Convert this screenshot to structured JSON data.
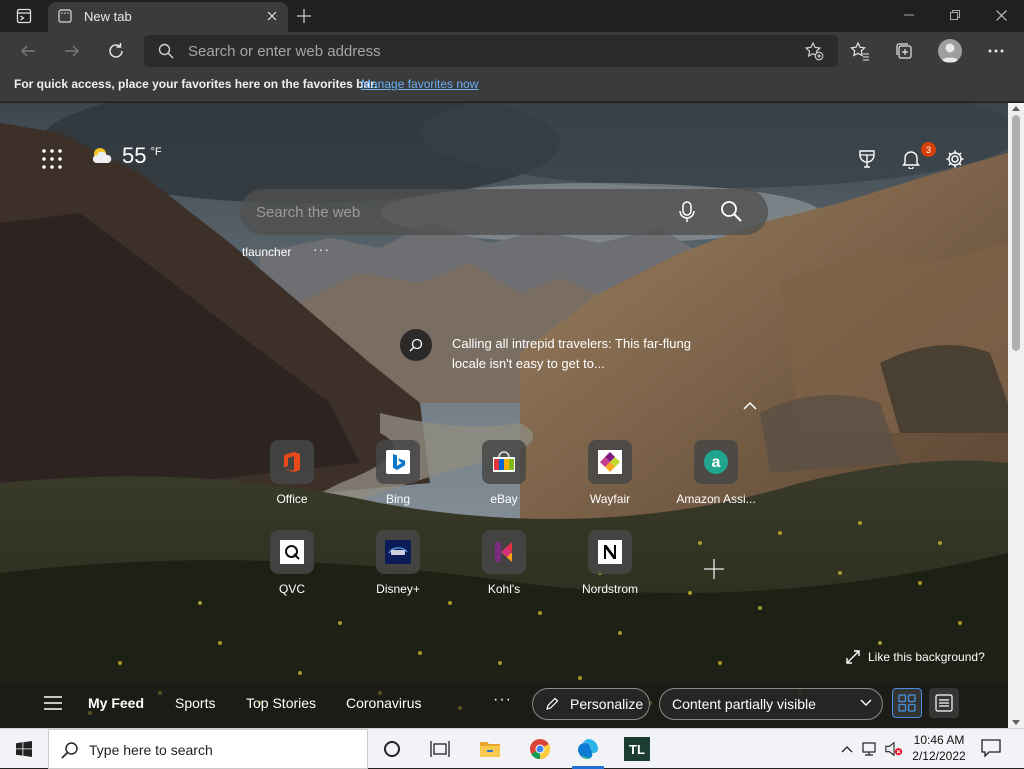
{
  "browser": {
    "tab_title": "New tab",
    "address_placeholder": "Search or enter web address",
    "favorites_bar_text": "For quick access, place your favorites here on the favorites bar.",
    "favorites_bar_link": "Manage favorites now"
  },
  "newtab": {
    "weather_temp": "55",
    "weather_unit": "°F",
    "notification_count": "3",
    "search_placeholder": "Search the web",
    "pinned_link_label": "tlauncher",
    "more_glyph": "···",
    "story_text": "Calling all intrepid travelers: This far-flung locale isn't easy to get to...",
    "quick_links": [
      {
        "label": "Office",
        "icon": "office-icon"
      },
      {
        "label": "Bing",
        "icon": "bing-icon"
      },
      {
        "label": "eBay",
        "icon": "ebay-icon"
      },
      {
        "label": "Wayfair",
        "icon": "wayfair-icon"
      },
      {
        "label": "Amazon Assi...",
        "icon": "amazon-assistant-icon"
      },
      {
        "label": "QVC",
        "icon": "qvc-icon"
      },
      {
        "label": "Disney+",
        "icon": "disney-plus-icon"
      },
      {
        "label": "Kohl's",
        "icon": "kohls-icon"
      },
      {
        "label": "Nordstrom",
        "icon": "nordstrom-icon"
      }
    ],
    "like_background": "Like this background?",
    "feed": {
      "items": [
        "My Feed",
        "Sports",
        "Top Stories",
        "Coronavirus"
      ],
      "active": "My Feed",
      "personalize": "Personalize",
      "content_visibility": "Content partially visible"
    }
  },
  "taskbar": {
    "search_placeholder": "Type here to search",
    "pinned": [
      "task-view-icon",
      "file-explorer-icon",
      "chrome-icon",
      "edge-icon",
      "tlauncher-icon"
    ],
    "tlauncher_text": "TL",
    "time": "10:46 AM",
    "date": "2/12/2022"
  },
  "colors": {
    "accent": "#6ab0f3",
    "badge": "#d74108",
    "chrome_dark": "#202020",
    "toolbar": "#3b3b3b",
    "taskbar_accent": "#1e6fd0"
  }
}
